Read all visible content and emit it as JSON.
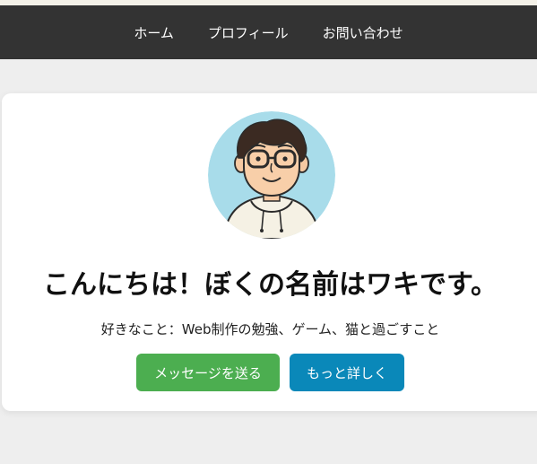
{
  "nav": {
    "items": [
      {
        "label": "ホーム"
      },
      {
        "label": "プロフィール"
      },
      {
        "label": "お問い合わせ"
      }
    ]
  },
  "profile": {
    "greeting": "こんにちは！ぼくの名前はワキです。",
    "hobbies": "好きなこと：Web制作の勉強、ゲーム、猫と過ごすこと"
  },
  "buttons": {
    "message_label": "メッセージを送る",
    "more_label": "もっと詳しく"
  },
  "colors": {
    "nav_bg": "#333333",
    "page_bg": "#eeeeee",
    "message_button": "#4cae50",
    "more_button": "#0a88b9",
    "avatar_bg": "#a8dcea"
  }
}
